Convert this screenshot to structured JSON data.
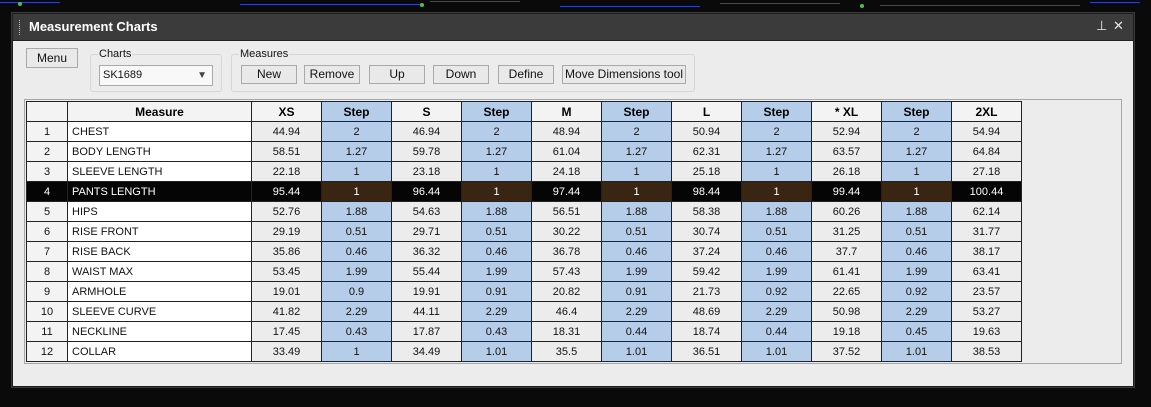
{
  "window": {
    "title": "Measurement Charts",
    "pin_icon": "pin-icon",
    "close_icon": "close-icon",
    "pin_glyph": "⊥",
    "close_glyph": "✕"
  },
  "toolbar": {
    "menu_label": "Menu",
    "charts_label": "Charts",
    "charts_value": "SK1689",
    "measures_label": "Measures",
    "buttons": [
      "New",
      "Remove",
      "Up",
      "Down",
      "Define",
      "Move Dimensions tool"
    ]
  },
  "table": {
    "columns": [
      "",
      "Measure",
      "XS",
      "Step",
      "S",
      "Step",
      "M",
      "Step",
      "L",
      "Step",
      "* XL",
      "Step",
      "2XL"
    ],
    "selected_row": 4,
    "rows": [
      [
        "1",
        "CHEST",
        "44.94",
        "2",
        "46.94",
        "2",
        "48.94",
        "2",
        "50.94",
        "2",
        "52.94",
        "2",
        "54.94"
      ],
      [
        "2",
        "BODY LENGTH",
        "58.51",
        "1.27",
        "59.78",
        "1.27",
        "61.04",
        "1.27",
        "62.31",
        "1.27",
        "63.57",
        "1.27",
        "64.84"
      ],
      [
        "3",
        "SLEEVE LENGTH",
        "22.18",
        "1",
        "23.18",
        "1",
        "24.18",
        "1",
        "25.18",
        "1",
        "26.18",
        "1",
        "27.18"
      ],
      [
        "4",
        "PANTS LENGTH",
        "95.44",
        "1",
        "96.44",
        "1",
        "97.44",
        "1",
        "98.44",
        "1",
        "99.44",
        "1",
        "100.44"
      ],
      [
        "5",
        "HIPS",
        "52.76",
        "1.88",
        "54.63",
        "1.88",
        "56.51",
        "1.88",
        "58.38",
        "1.88",
        "60.26",
        "1.88",
        "62.14"
      ],
      [
        "6",
        "RISE FRONT",
        "29.19",
        "0.51",
        "29.71",
        "0.51",
        "30.22",
        "0.51",
        "30.74",
        "0.51",
        "31.25",
        "0.51",
        "31.77"
      ],
      [
        "7",
        "RISE BACK",
        "35.86",
        "0.46",
        "36.32",
        "0.46",
        "36.78",
        "0.46",
        "37.24",
        "0.46",
        "37.7",
        "0.46",
        "38.17"
      ],
      [
        "8",
        "WAIST MAX",
        "53.45",
        "1.99",
        "55.44",
        "1.99",
        "57.43",
        "1.99",
        "59.42",
        "1.99",
        "61.41",
        "1.99",
        "63.41"
      ],
      [
        "9",
        "ARMHOLE",
        "19.01",
        "0.9",
        "19.91",
        "0.91",
        "20.82",
        "0.91",
        "21.73",
        "0.92",
        "22.65",
        "0.92",
        "23.57"
      ],
      [
        "10",
        "SLEEVE CURVE",
        "41.82",
        "2.29",
        "44.11",
        "2.29",
        "46.4",
        "2.29",
        "48.69",
        "2.29",
        "50.98",
        "2.29",
        "53.27"
      ],
      [
        "11",
        "NECKLINE",
        "17.45",
        "0.43",
        "17.87",
        "0.43",
        "18.31",
        "0.44",
        "18.74",
        "0.44",
        "19.18",
        "0.45",
        "19.63"
      ],
      [
        "12",
        "COLLAR",
        "33.49",
        "1",
        "34.49",
        "1.01",
        "35.5",
        "1.01",
        "36.51",
        "1.01",
        "37.52",
        "1.01",
        "38.53"
      ]
    ]
  }
}
